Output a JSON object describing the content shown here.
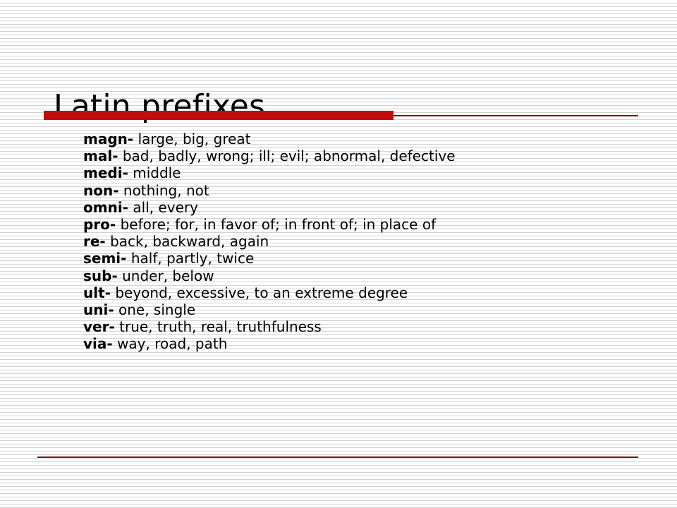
{
  "slide": {
    "title": "Latin prefixes",
    "colors": {
      "accent_bar": "#c00d0d",
      "title_rule": "#7b0d11",
      "footer_rule": "#7b1419",
      "text": "#000000",
      "background": "#ffffff",
      "background_stripe": "#d2d2d2"
    },
    "entries": [
      {
        "term": "magn-",
        "definition": "large, big, great"
      },
      {
        "term": "mal-",
        "definition": "bad, badly, wrong; ill; evil; abnormal, defective"
      },
      {
        "term": "medi-",
        "definition": "middle"
      },
      {
        "term": "non-",
        "definition": "nothing, not"
      },
      {
        "term": "omni-",
        "definition": "all, every"
      },
      {
        "term": "pro-",
        "definition": "before; for, in favor of; in front of; in place of"
      },
      {
        "term": "re-",
        "definition": "back, backward, again"
      },
      {
        "term": "semi-",
        "definition": "half, partly, twice"
      },
      {
        "term": "sub-",
        "definition": "under, below"
      },
      {
        "term": "ult-",
        "definition": "beyond, excessive, to an extreme degree"
      },
      {
        "term": "uni-",
        "definition": "one, single"
      },
      {
        "term": "ver-",
        "definition": "true, truth, real, truthfulness"
      },
      {
        "term": "via-",
        "definition": "way, road, path"
      }
    ]
  }
}
